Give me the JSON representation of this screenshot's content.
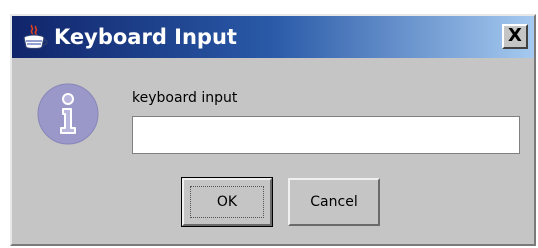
{
  "window": {
    "title": "Keyboard Input",
    "close_label": "X",
    "title_icon": "java-cup-icon"
  },
  "dialog": {
    "icon": "information-icon",
    "prompt": "keyboard input",
    "input_value": "",
    "ok_label": "OK",
    "cancel_label": "Cancel"
  },
  "colors": {
    "titlebar_start": "#10246a",
    "titlebar_end": "#a6caf0",
    "dialog_background": "#c5c5c5",
    "info_icon": "#9a98c8"
  }
}
